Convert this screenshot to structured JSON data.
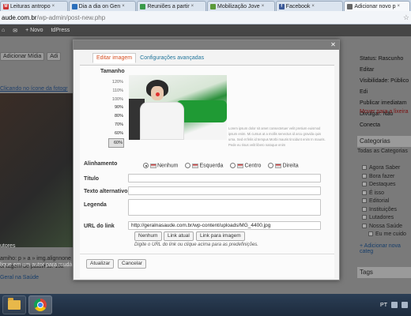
{
  "browser": {
    "tabs": [
      {
        "label": "Leituras antropo",
        "color": "#c33"
      },
      {
        "label": "Dia a dia on Gen",
        "color": "#2a6ebb"
      },
      {
        "label": "Reuniões a partir",
        "color": "#3a9a4a"
      },
      {
        "label": "Mobilização Jove",
        "color": "#5b9a3a"
      },
      {
        "label": "Facebook",
        "color": "#3b5998"
      },
      {
        "label": "Adicionar novo p",
        "color": "#666"
      }
    ],
    "url_host": "aude.com.br",
    "url_path": "/wp-admin/post-new.php"
  },
  "adminbar": {
    "new_label": "+ Novo",
    "plugin_label": "tdPress"
  },
  "background": {
    "add_media": "Adicionar Mídia",
    "add_media_2": "Adi",
    "link_text": "Clicando no ícone da fotogr",
    "path_text": "amiho: p » a » img.alignnone",
    "word_count": "ontagem de palavras: 152",
    "autores": "utores",
    "autor_hint": "lique em um autor para mudá-l",
    "geral": "Geral na Saúde",
    "status_lines": [
      "Status: Rascunho Editar",
      "Visibilidade: Público Edi",
      "Publicar imediatam",
      "Divulgar: Não Conecta"
    ],
    "trash": "Mover para a lixeira",
    "categories_title": "Categorias",
    "categories_sub": "Todas as Categorias",
    "categories": [
      "Agora Saber",
      "Bora fazer",
      "Destaques",
      "É isso",
      "Editorial",
      "Instituições",
      "Lutadores",
      "Nossa Saúde",
      "Eu me cuido"
    ],
    "add_category": "+ Adicionar nova categ",
    "tags_title": "Tags"
  },
  "modal": {
    "tabs": [
      "Editar imagem",
      "Configurações avançadas"
    ],
    "size_label": "Tamanho",
    "sizes": [
      "120%",
      "110%",
      "100%",
      "90%",
      "80%",
      "70%",
      "60%"
    ],
    "selected_size": "60%",
    "lorem": "Lorem ipsum dolor sit amet consectetuer velit pretium euismod ipsum enim. Mi cursus at a mollis senectus id arcu gravida quis urna. Sed et felis id tempus Morbi mauris tincidunt enim In mauris. Pede eu risus velit libero natoque enim",
    "align_label": "Alinhamento",
    "align_options": [
      "Nenhum",
      "Esquerda",
      "Centro",
      "Direita"
    ],
    "selected_align": "Nenhum",
    "title_label": "Título",
    "title_value": "",
    "alt_label": "Texto alternativo",
    "alt_value": "",
    "caption_label": "Legenda",
    "caption_value": "",
    "url_label": "URL do link",
    "url_value": "http://geralnasaude.com.br/wp-content/uploads/MG_4400.jpg",
    "link_buttons": [
      "Nenhum",
      "Link atual",
      "Link para imagem"
    ],
    "hint": "Digite o URL do link ou clique acima para as predefinições.",
    "update_button": "Atualizar",
    "cancel_button": "Cancelar"
  },
  "taskbar": {
    "lang": "PT"
  }
}
